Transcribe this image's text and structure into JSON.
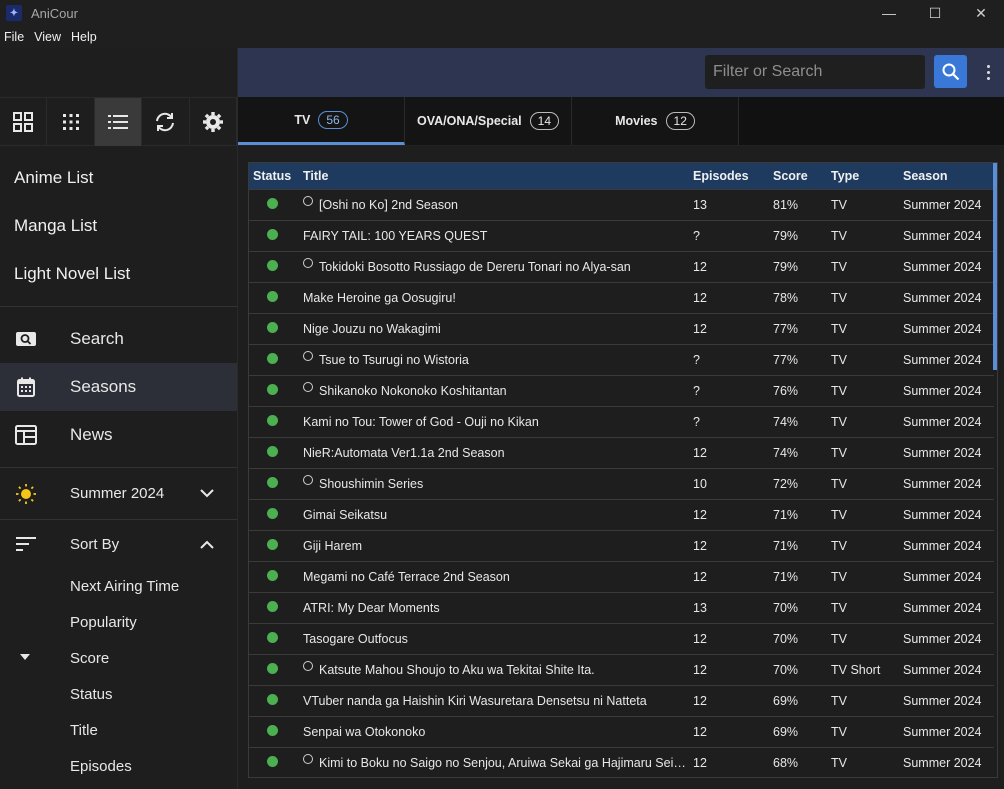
{
  "window": {
    "title": "AniCour",
    "app_icon": "anicour-logo",
    "minimize": "—",
    "maximize": "☐",
    "close": "✕"
  },
  "menu": {
    "items": [
      "File",
      "View",
      "Help"
    ]
  },
  "search": {
    "placeholder": "Filter or Search",
    "value": ""
  },
  "sidebar": {
    "lists": [
      "Anime List",
      "Manga List",
      "Light Novel List"
    ],
    "nav": [
      {
        "label": "Search",
        "icon": "search-icon"
      },
      {
        "label": "Seasons",
        "icon": "calendar-icon",
        "active": true
      },
      {
        "label": "News",
        "icon": "news-icon"
      }
    ],
    "season": {
      "label": "Summer 2024",
      "icon": "sun-icon"
    },
    "sort": {
      "label": "Sort By",
      "options": [
        "Next Airing Time",
        "Popularity",
        "Score",
        "Status",
        "Title",
        "Episodes"
      ],
      "selected": "Score"
    }
  },
  "tabs": [
    {
      "label": "TV",
      "count": "56"
    },
    {
      "label": "OVA/ONA/Special",
      "count": "14"
    },
    {
      "label": "Movies",
      "count": "12"
    }
  ],
  "table": {
    "columns": [
      "Status",
      "Title",
      "Episodes",
      "Score",
      "Type",
      "Season"
    ],
    "rows": [
      {
        "title": "[Oshi no Ko] 2nd Season",
        "airing": true,
        "episodes": "13",
        "score": "81%",
        "type": "TV",
        "season": "Summer 2024"
      },
      {
        "title": "FAIRY TAIL: 100 YEARS QUEST",
        "airing": false,
        "episodes": "?",
        "score": "79%",
        "type": "TV",
        "season": "Summer 2024"
      },
      {
        "title": "Tokidoki Bosotto Russiago de Dereru Tonari no Alya-san",
        "airing": true,
        "episodes": "12",
        "score": "79%",
        "type": "TV",
        "season": "Summer 2024"
      },
      {
        "title": "Make Heroine ga Oosugiru!",
        "airing": false,
        "episodes": "12",
        "score": "78%",
        "type": "TV",
        "season": "Summer 2024"
      },
      {
        "title": "Nige Jouzu no Wakagimi",
        "airing": false,
        "episodes": "12",
        "score": "77%",
        "type": "TV",
        "season": "Summer 2024"
      },
      {
        "title": "Tsue to Tsurugi no Wistoria",
        "airing": true,
        "episodes": "?",
        "score": "77%",
        "type": "TV",
        "season": "Summer 2024"
      },
      {
        "title": "Shikanoko Nokonoko Koshitantan",
        "airing": true,
        "episodes": "?",
        "score": "76%",
        "type": "TV",
        "season": "Summer 2024"
      },
      {
        "title": "Kami no Tou: Tower of God - Ouji no Kikan",
        "airing": false,
        "episodes": "?",
        "score": "74%",
        "type": "TV",
        "season": "Summer 2024"
      },
      {
        "title": "NieR:Automata Ver1.1a 2nd Season",
        "airing": false,
        "episodes": "12",
        "score": "74%",
        "type": "TV",
        "season": "Summer 2024"
      },
      {
        "title": "Shoushimin Series",
        "airing": true,
        "episodes": "10",
        "score": "72%",
        "type": "TV",
        "season": "Summer 2024"
      },
      {
        "title": "Gimai Seikatsu",
        "airing": false,
        "episodes": "12",
        "score": "71%",
        "type": "TV",
        "season": "Summer 2024"
      },
      {
        "title": "Giji Harem",
        "airing": false,
        "episodes": "12",
        "score": "71%",
        "type": "TV",
        "season": "Summer 2024"
      },
      {
        "title": "Megami no Café Terrace 2nd Season",
        "airing": false,
        "episodes": "12",
        "score": "71%",
        "type": "TV",
        "season": "Summer 2024"
      },
      {
        "title": "ATRI: My Dear Moments",
        "airing": false,
        "episodes": "13",
        "score": "70%",
        "type": "TV",
        "season": "Summer 2024"
      },
      {
        "title": "Tasogare Outfocus",
        "airing": false,
        "episodes": "12",
        "score": "70%",
        "type": "TV",
        "season": "Summer 2024"
      },
      {
        "title": "Katsute Mahou Shoujo to Aku wa Tekitai Shite Ita.",
        "airing": true,
        "episodes": "12",
        "score": "70%",
        "type": "TV Short",
        "season": "Summer 2024"
      },
      {
        "title": "VTuber nanda ga Haishin Kiri Wasuretara Densetsu ni Natteta",
        "airing": false,
        "episodes": "12",
        "score": "69%",
        "type": "TV",
        "season": "Summer 2024"
      },
      {
        "title": "Senpai wa Otokonoko",
        "airing": false,
        "episodes": "12",
        "score": "69%",
        "type": "TV",
        "season": "Summer 2024"
      },
      {
        "title": "Kimi to Boku no Saigo no Senjou, Aruiwa Sekai ga Hajimaru Seisen Season II",
        "airing": true,
        "episodes": "12",
        "score": "68%",
        "type": "TV",
        "season": "Summer 2024"
      }
    ]
  },
  "colors": {
    "accent": "#3a78d8",
    "status_airing": "#4caf50",
    "header_row": "#1f3a5f",
    "header_bar": "#2e3550"
  }
}
